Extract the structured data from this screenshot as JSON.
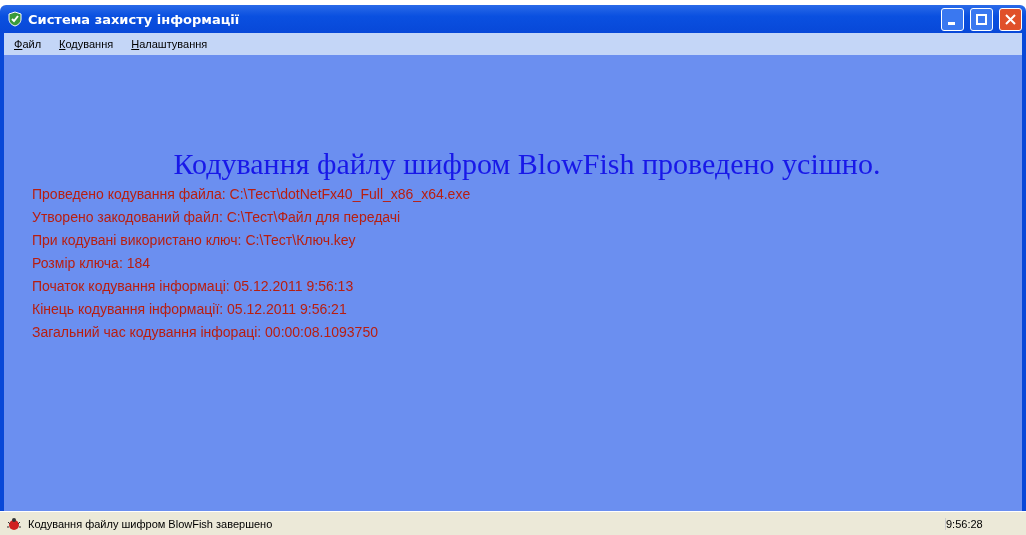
{
  "window": {
    "title": "Система захисту інформації"
  },
  "menu": [
    "Файл",
    "Кодування",
    "Налаштування"
  ],
  "heading": "Кодування файлу шифром BlowFish проведено усішно.",
  "log": [
    "Проведено кодування файла: C:\\Тест\\dotNetFx40_Full_x86_x64.exe",
    "Утворено закодований файл: C:\\Тест\\Файл для передачі",
    "При кодувані використано ключ: C:\\Тест\\Ключ.key",
    "Розмір ключа: 184",
    "Початок кодування інформаці: 05.12.2011 9:56:13",
    "Кінець кодування інформації: 05.12.2011 9:56:21",
    "Загальний час кодування інфораці: 00:00:08.1093750"
  ],
  "status_bar": {
    "message": "Кодування файлу шифром BlowFish завершено",
    "time": "9:56:28"
  }
}
